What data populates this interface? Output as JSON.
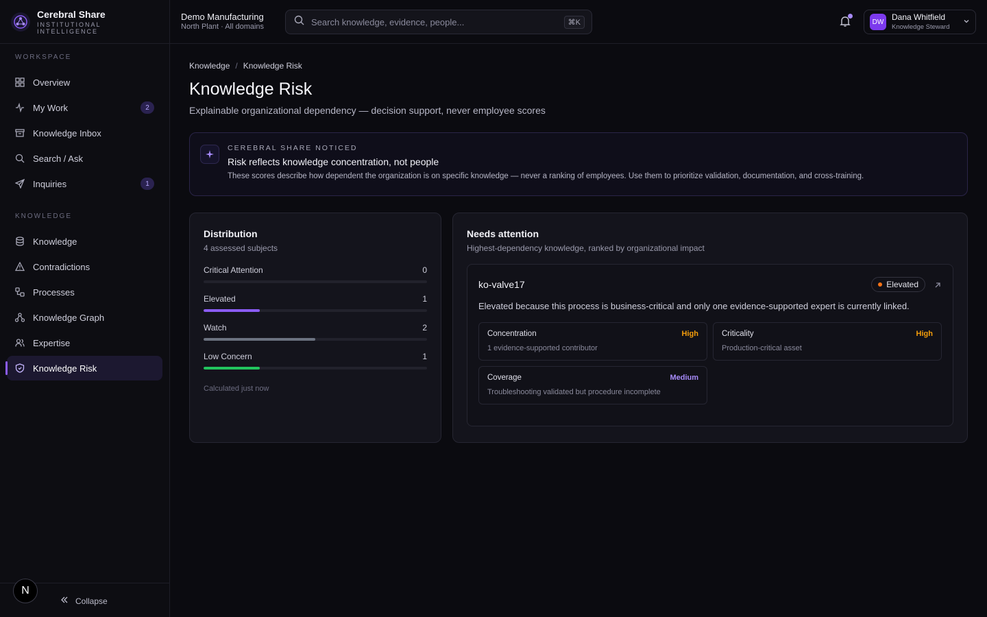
{
  "brand": {
    "name": "Cerebral Share",
    "tagline": "INSTITUTIONAL INTELLIGENCE"
  },
  "sidebar": {
    "workspace_label": "WORKSPACE",
    "workspace_items": [
      {
        "label": "Overview",
        "icon": "grid-icon"
      },
      {
        "label": "My Work",
        "icon": "activity-icon",
        "badge": "2"
      },
      {
        "label": "Knowledge Inbox",
        "icon": "inbox-icon"
      },
      {
        "label": "Search / Ask",
        "icon": "search-icon"
      },
      {
        "label": "Inquiries",
        "icon": "send-icon",
        "badge": "1"
      }
    ],
    "knowledge_label": "KNOWLEDGE",
    "knowledge_items": [
      {
        "label": "Knowledge",
        "icon": "database-icon"
      },
      {
        "label": "Contradictions",
        "icon": "warning-icon"
      },
      {
        "label": "Processes",
        "icon": "workflow-icon"
      },
      {
        "label": "Knowledge Graph",
        "icon": "graph-icon"
      },
      {
        "label": "Expertise",
        "icon": "users-icon"
      },
      {
        "label": "Knowledge Risk",
        "icon": "shield-icon",
        "active": true
      }
    ],
    "footer": {
      "avatar_letter": "N",
      "collapse_label": "Collapse"
    }
  },
  "topbar": {
    "org_name": "Demo Manufacturing",
    "org_scope": "North Plant · All domains",
    "search_placeholder": "Search knowledge, evidence, people...",
    "shortcut": "⌘K",
    "user": {
      "initials": "DW",
      "name": "Dana Whitfield",
      "role": "Knowledge Steward"
    }
  },
  "breadcrumb": {
    "parent": "Knowledge",
    "separator": "/",
    "current": "Knowledge Risk"
  },
  "page": {
    "title": "Knowledge Risk",
    "subtitle": "Explainable organizational dependency — decision support, never employee scores"
  },
  "notice": {
    "label": "CEREBRAL SHARE NOTICED",
    "title": "Risk reflects knowledge concentration, not people",
    "body": "These scores describe how dependent the organization is on specific knowledge — never a ranking of employees. Use them to prioritize validation, documentation, and cross-training."
  },
  "distribution": {
    "title": "Distribution",
    "subtitle": "4 assessed subjects",
    "total": 4,
    "rows": [
      {
        "label": "Critical Attention",
        "count": "0",
        "value": 0,
        "color": "#ef4444"
      },
      {
        "label": "Elevated",
        "count": "1",
        "value": 1,
        "color": "#8b5cf6"
      },
      {
        "label": "Watch",
        "count": "2",
        "value": 2,
        "color": "#6b7280"
      },
      {
        "label": "Low Concern",
        "count": "1",
        "value": 1,
        "color": "#22c55e"
      }
    ],
    "calculated": "Calculated just now"
  },
  "needs_attention": {
    "title": "Needs attention",
    "subtitle": "Highest-dependency knowledge, ranked by organizational impact",
    "item": {
      "name": "ko-valve17",
      "status": "Elevated",
      "status_color": "#f97316",
      "description": "Elevated because this process is business-critical and only one evidence-supported expert is currently linked.",
      "factors": [
        {
          "name": "Concentration",
          "level": "High",
          "level_color": "#f59e0b",
          "detail": "1 evidence-supported contributor"
        },
        {
          "name": "Criticality",
          "level": "High",
          "level_color": "#f59e0b",
          "detail": "Production-critical asset"
        },
        {
          "name": "Coverage",
          "level": "Medium",
          "level_color": "#a78bfa",
          "detail": "Troubleshooting validated but procedure incomplete"
        }
      ]
    }
  }
}
